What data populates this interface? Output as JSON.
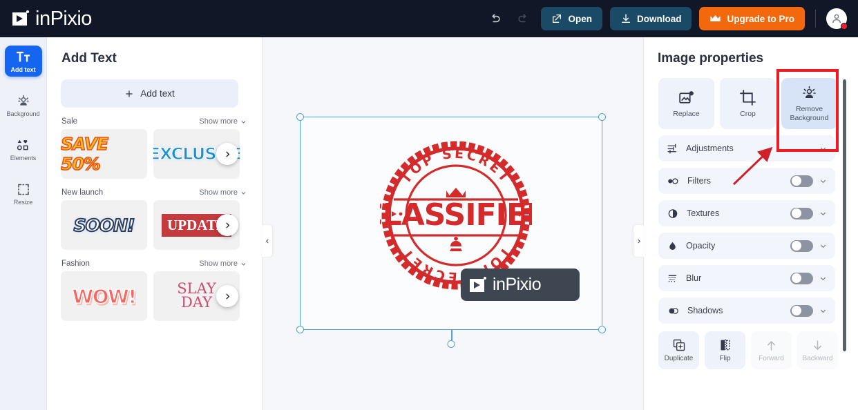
{
  "app": {
    "name": "inPixio",
    "logo_icon": "play-logo-icon"
  },
  "topbar": {
    "undo_icon": "undo-arrow-icon",
    "redo_icon": "redo-arrow-icon",
    "open_label": "Open",
    "open_icon": "open-external-icon",
    "download_label": "Download",
    "download_icon": "download-arrow-icon",
    "upgrade_label": "Upgrade to Pro",
    "upgrade_icon": "crown-icon",
    "avatar_icon": "user-avatar-icon",
    "accent_orange": "#f2690d",
    "button_dark_blue": "#1b4a66",
    "bar_bg": "#111726"
  },
  "rail": {
    "items": [
      {
        "label": "Add text",
        "icon": "text-tt-icon",
        "active": true
      },
      {
        "label": "Background",
        "icon": "background-person-icon",
        "active": false
      },
      {
        "label": "Elements",
        "icon": "shapes-icon",
        "active": false
      },
      {
        "label": "Resize",
        "icon": "resize-frame-icon",
        "active": false
      }
    ],
    "active_color": "#1565f0"
  },
  "left_panel": {
    "title": "Add Text",
    "add_text_button": "Add text",
    "add_text_icon": "plus-icon",
    "show_more_label": "Show more",
    "next_icon": "chevron-right-icon",
    "categories": [
      {
        "name": "Sale",
        "templates": [
          "SAVE 50%",
          "EXCLUSIVE"
        ]
      },
      {
        "name": "New launch",
        "templates": [
          "SOON!",
          "UPDATE"
        ]
      },
      {
        "name": "Fashion",
        "templates": [
          "WOW!",
          "SLAY\nDAY"
        ]
      }
    ]
  },
  "canvas": {
    "collapse_left_icon": "chevron-left-icon",
    "collapse_right_icon": "chevron-right-icon",
    "image": {
      "type": "rubber-stamp",
      "top_arc_text": "TOP SECRET",
      "center_text": "CLASSIFIED",
      "bottom_arc_text": "TOP SECRET",
      "crown_icon": "crown-icon",
      "stamp_color": "#d32b2b"
    },
    "watermark": {
      "text": "inPixio",
      "icon": "play-logo-icon",
      "bg": "#3e4651"
    },
    "selection": {
      "handle_icon": "resize-handle",
      "rotate_icon": "rotate-handle",
      "color": "#4d9fdb"
    }
  },
  "right_panel": {
    "title": "Image properties",
    "tools": [
      {
        "label": "Replace",
        "icon": "replace-image-icon",
        "highlighted": false
      },
      {
        "label": "Crop",
        "icon": "crop-icon",
        "highlighted": false
      },
      {
        "label": "Remove Background",
        "icon": "remove-background-icon",
        "highlighted": true
      }
    ],
    "options": [
      {
        "label": "Adjustments",
        "icon": "sliders-icon",
        "toggle": false,
        "chevron": "chevron-down-icon"
      },
      {
        "label": "Filters",
        "icon": "filters-circles-icon",
        "toggle": true,
        "enabled": false,
        "chevron": "chevron-down-icon"
      },
      {
        "label": "Textures",
        "icon": "contrast-circle-icon",
        "toggle": true,
        "enabled": false,
        "chevron": "chevron-down-icon"
      },
      {
        "label": "Opacity",
        "icon": "droplet-icon",
        "toggle": true,
        "enabled": false,
        "chevron": "chevron-down-icon"
      },
      {
        "label": "Blur",
        "icon": "blur-grid-icon",
        "toggle": true,
        "enabled": false,
        "chevron": "chevron-down-icon"
      },
      {
        "label": "Shadows",
        "icon": "shadow-circles-icon",
        "toggle": true,
        "enabled": false,
        "chevron": "chevron-down-icon"
      }
    ],
    "actions": [
      {
        "label": "Duplicate",
        "icon": "duplicate-icon",
        "disabled": false
      },
      {
        "label": "Flip",
        "icon": "flip-horizontal-icon",
        "disabled": false
      },
      {
        "label": "Forward",
        "icon": "arrow-up-icon",
        "disabled": true
      },
      {
        "label": "Backward",
        "icon": "arrow-down-icon",
        "disabled": true
      }
    ]
  },
  "annotations": {
    "highlight_color": "#ed1c24",
    "highlight_target": "Remove Background",
    "arrow_icon": "pointer-arrow-icon"
  }
}
